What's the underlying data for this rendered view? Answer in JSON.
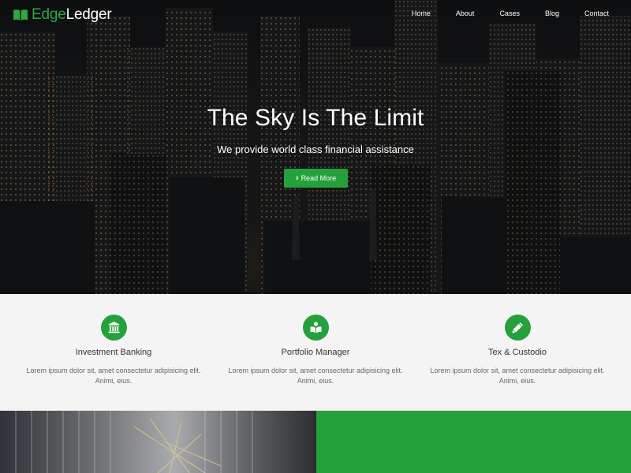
{
  "brand": {
    "name_part1": "Edge",
    "name_part2": "Ledger",
    "icon": "open-book-icon",
    "accent_color": "#25a13c"
  },
  "nav": {
    "items": [
      "Home",
      "About",
      "Cases",
      "Blog",
      "Contact"
    ]
  },
  "hero": {
    "title": "The Sky Is The Limit",
    "subtitle": "We provide world class financial assistance",
    "button_icon": "chevron-right-icon",
    "button_label": "Read More",
    "background": "night-city-skyline-photo"
  },
  "features": [
    {
      "icon": "bank-icon",
      "title": "Investment Banking",
      "text": "Lorem ipsum dolor sit, amet consectetur adipisicing elit. Animi, eius."
    },
    {
      "icon": "book-reader-icon",
      "title": "Portfolio Manager",
      "text": "Lorem ipsum dolor sit, amet consectetur adipisicing elit. Animi, eius."
    },
    {
      "icon": "pencil-icon",
      "title": "Tex & Custodio",
      "text": "Lorem ipsum dolor sit, amet consectetur adipisicing elit. Animi, eius."
    }
  ],
  "bottom": {
    "left": "office-building-interior-photo",
    "right_color": "#25a13c"
  }
}
